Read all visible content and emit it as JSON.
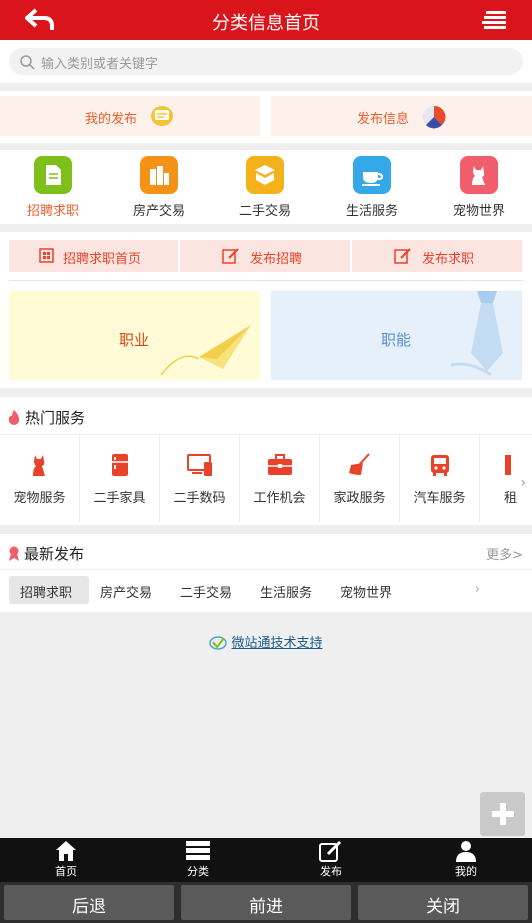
{
  "header": {
    "title": "分类信息首页",
    "back_icon": "back-arrow-icon",
    "menu_icon": "menu-icon"
  },
  "search": {
    "placeholder": "输入类别或者关键字"
  },
  "publish": {
    "my_posts": "我的发布",
    "post_info": "发布信息"
  },
  "categories": [
    {
      "label": "招聘求职",
      "icon": "document-icon",
      "color": "#7fbf1a"
    },
    {
      "label": "房产交易",
      "icon": "building-icon",
      "color": "#f39217"
    },
    {
      "label": "二手交易",
      "icon": "box-icon",
      "color": "#f4b21a"
    },
    {
      "label": "生活服务",
      "icon": "cup-icon",
      "color": "#35a8e8"
    },
    {
      "label": "宠物世界",
      "icon": "cat-icon",
      "color": "#f05d6c"
    }
  ],
  "sub_nav": {
    "home": "招聘求职首页",
    "post_job": "发布招聘",
    "post_seek": "发布求职"
  },
  "banners": {
    "career": "职业",
    "function": "职能"
  },
  "hot_services": {
    "title": "热门服务",
    "items": [
      {
        "label": "宠物服务",
        "icon": "cat-icon"
      },
      {
        "label": "二手家具",
        "icon": "fridge-icon"
      },
      {
        "label": "二手数码",
        "icon": "devices-icon"
      },
      {
        "label": "工作机会",
        "icon": "briefcase-icon"
      },
      {
        "label": "家政服务",
        "icon": "broom-icon"
      },
      {
        "label": "汽车服务",
        "icon": "bus-icon"
      },
      {
        "label": "租",
        "icon": "rent-icon"
      }
    ],
    "arrow": "›"
  },
  "latest": {
    "title": "最新发布",
    "more": "更多>",
    "tabs": [
      "招聘求职",
      "房产交易",
      "二手交易",
      "生活服务",
      "宠物世界"
    ],
    "arrow": "›"
  },
  "support": "微站通技术支持",
  "bottom_nav": [
    {
      "label": "首页",
      "icon": "home-icon"
    },
    {
      "label": "分类",
      "icon": "list-icon"
    },
    {
      "label": "发布",
      "icon": "edit-icon"
    },
    {
      "label": "我的",
      "icon": "user-icon"
    }
  ],
  "browser_bar": {
    "back": "后退",
    "forward": "前进",
    "close": "关闭"
  },
  "colors": {
    "header": "#d9151b",
    "accent": "#e8602f",
    "sub_nav_text": "#e8432a"
  }
}
